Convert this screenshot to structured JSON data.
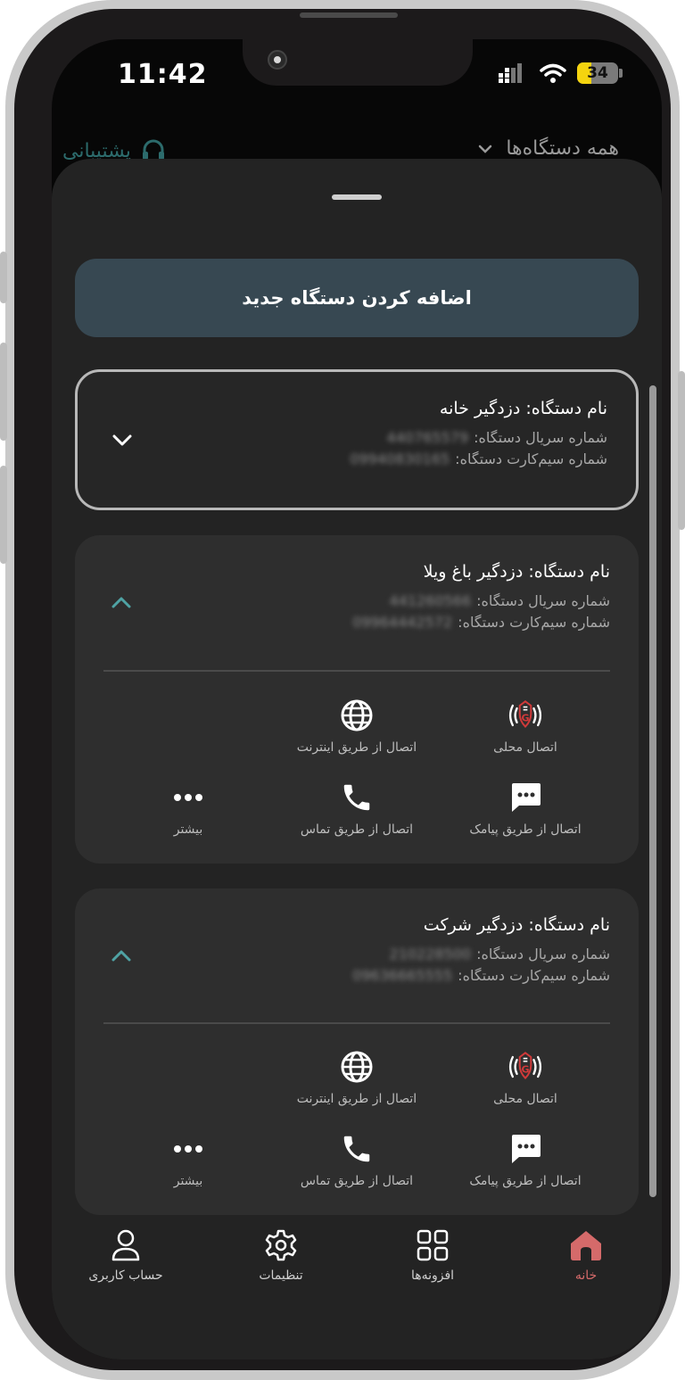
{
  "status_bar": {
    "time": "11:42",
    "battery": "34",
    "battery_level": 0.34
  },
  "topbar": {
    "support_label": "پشتیبانی",
    "device_filter_label": "همه دستگاه‌ها"
  },
  "add_button": {
    "label": "اضافه کردن دستگاه جدید"
  },
  "labels": {
    "name_prefix": "نام دستگاه:",
    "serial_prefix": "شماره سریال دستگاه:",
    "sim_prefix": "شماره سیم‌کارت دستگاه:"
  },
  "devices": [
    {
      "name": "دزدگیر خانه",
      "serial": "440765579",
      "sim": "09940830165",
      "expanded": false
    },
    {
      "name": "دزدگیر باغ ویلا",
      "serial": "441260566",
      "sim": "09964442572",
      "expanded": true
    },
    {
      "name": "دزدگیر شرکت",
      "serial": "210228500",
      "sim": "09636665555",
      "expanded": true
    }
  ],
  "actions": {
    "local": "اتصال محلی",
    "internet": "اتصال از طریق اینترنت",
    "sms": "اتصال از طریق پیامک",
    "call": "اتصال از طریق تماس",
    "more": "بیشتر"
  },
  "nav": {
    "home": "خانه",
    "addons": "افزونه‌ها",
    "settings": "تنظیمات",
    "account": "حساب کاربری"
  },
  "colors": {
    "accent": "#d56a6a",
    "teal": "#4fa3a4",
    "primary_button": "#374852"
  }
}
